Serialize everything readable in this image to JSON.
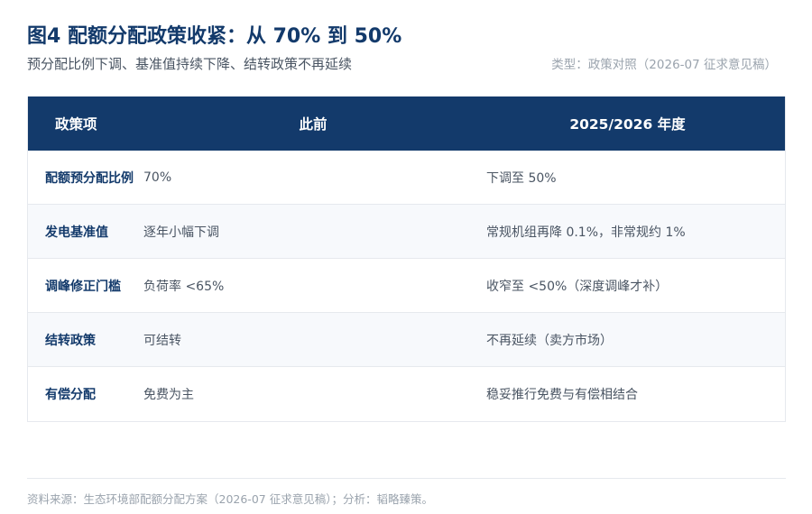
{
  "header": {
    "title": "图4 配额分配政策收紧：从 70% 到 50%",
    "subtitle": "预分配比例下调、基准值持续下降、结转政策不再延续",
    "type_note": "类型：政策对照（2026-07 征求意见稿）"
  },
  "table": {
    "columns": [
      "政策项",
      "此前",
      "2025/2026 年度"
    ],
    "rows": [
      {
        "policy": "配额预分配比例",
        "before": "70%",
        "after": "下调至 50%"
      },
      {
        "policy": "发电基准值",
        "before": "逐年小幅下调",
        "after": "常规机组再降 0.1%，非常规约 1%"
      },
      {
        "policy": "调峰修正门槛",
        "before": "负荷率 <65%",
        "after": "收窄至 <50%（深度调峰才补）"
      },
      {
        "policy": "结转政策",
        "before": "可结转",
        "after": "不再延续（卖方市场）"
      },
      {
        "policy": "有偿分配",
        "before": "免费为主",
        "after": "稳妥推行免费与有偿相结合"
      }
    ]
  },
  "footer": {
    "source": "资料来源：生态环境部配额分配方案（2026-07 征求意见稿）；分析：韬略臻策。"
  },
  "colors": {
    "header_bg": "#133a6b",
    "title": "#133a6b",
    "alt_row": "#f7f9fc"
  }
}
